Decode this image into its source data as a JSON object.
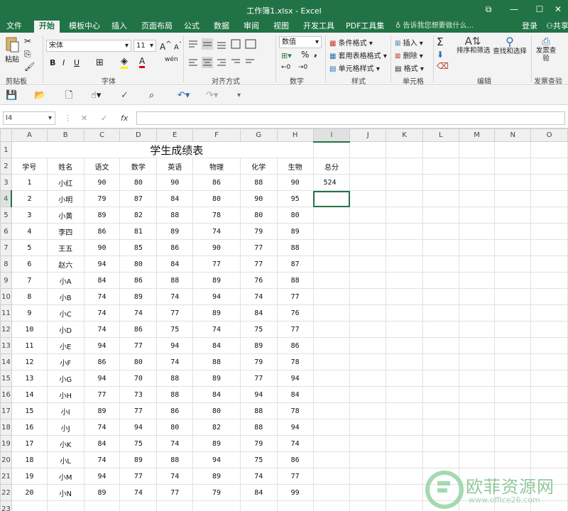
{
  "window": {
    "title": "工作簿1.xlsx - Excel",
    "controls": [
      "⧉",
      "—",
      "☐",
      "✕"
    ]
  },
  "tabs": [
    "文件",
    "开始",
    "模板中心",
    "插入",
    "页面布局",
    "公式",
    "数据",
    "审阅",
    "视图",
    "开发工具",
    "PDF工具集"
  ],
  "active_tab": "开始",
  "tell_me": "告诉我您想要做什么...",
  "login": "登录",
  "share": "共享",
  "ribbon": {
    "clipboard": {
      "paste": "粘贴",
      "label": "剪贴板"
    },
    "font": {
      "name": "宋体",
      "size": "11",
      "grow": "A",
      "shrink": "A",
      "bold": "B",
      "italic": "I",
      "underline": "U",
      "wen": "wén",
      "label": "字体"
    },
    "alignment": {
      "label": "对齐方式"
    },
    "number": {
      "format": "数值",
      "percent": "%",
      "comma": ",",
      "label": "数字"
    },
    "styles": {
      "conditional": "条件格式",
      "table": "套用表格格式",
      "cell": "单元格样式",
      "label": "样式"
    },
    "cells": {
      "insert": "插入",
      "delete": "删除",
      "format": "格式",
      "label": "单元格"
    },
    "editing": {
      "sum": "Σ",
      "sort": "排序和筛选",
      "find": "查找和选择",
      "label": "编辑"
    },
    "invoice": {
      "check": "发票查验",
      "label": "发票查验"
    }
  },
  "formula_bar": {
    "name_box": "I4",
    "cancel": "✕",
    "confirm": "✓",
    "fx": "fx",
    "value": ""
  },
  "columns": [
    "A",
    "B",
    "C",
    "D",
    "E",
    "F",
    "G",
    "H",
    "I",
    "J",
    "K",
    "L",
    "M",
    "N",
    "O"
  ],
  "selected_cell": "I4",
  "sheet": {
    "title": "学生成绩表",
    "headers": [
      "学号",
      "姓名",
      "语文",
      "数学",
      "英语",
      "物理",
      "化学",
      "生物",
      "总分"
    ],
    "rows": [
      [
        "1",
        "小红",
        "90",
        "80",
        "90",
        "86",
        "88",
        "90",
        "524"
      ],
      [
        "2",
        "小明",
        "79",
        "87",
        "84",
        "80",
        "90",
        "95",
        ""
      ],
      [
        "3",
        "小黄",
        "89",
        "82",
        "88",
        "78",
        "80",
        "80",
        ""
      ],
      [
        "4",
        "李四",
        "86",
        "81",
        "89",
        "74",
        "79",
        "89",
        ""
      ],
      [
        "5",
        "王五",
        "90",
        "85",
        "86",
        "90",
        "77",
        "88",
        ""
      ],
      [
        "6",
        "赵六",
        "94",
        "80",
        "84",
        "77",
        "77",
        "87",
        ""
      ],
      [
        "7",
        "小A",
        "84",
        "86",
        "88",
        "89",
        "76",
        "88",
        ""
      ],
      [
        "8",
        "小B",
        "74",
        "89",
        "74",
        "94",
        "74",
        "77",
        ""
      ],
      [
        "9",
        "小C",
        "74",
        "74",
        "77",
        "89",
        "84",
        "76",
        ""
      ],
      [
        "10",
        "小D",
        "74",
        "86",
        "75",
        "74",
        "75",
        "77",
        ""
      ],
      [
        "11",
        "小E",
        "94",
        "77",
        "94",
        "84",
        "89",
        "86",
        ""
      ],
      [
        "12",
        "小F",
        "86",
        "80",
        "74",
        "88",
        "79",
        "78",
        ""
      ],
      [
        "13",
        "小G",
        "94",
        "70",
        "88",
        "89",
        "77",
        "94",
        ""
      ],
      [
        "14",
        "小H",
        "77",
        "73",
        "88",
        "84",
        "94",
        "84",
        ""
      ],
      [
        "15",
        "小I",
        "89",
        "77",
        "86",
        "80",
        "88",
        "78",
        ""
      ],
      [
        "16",
        "小J",
        "74",
        "94",
        "80",
        "82",
        "88",
        "94",
        ""
      ],
      [
        "17",
        "小K",
        "84",
        "75",
        "74",
        "89",
        "79",
        "74",
        ""
      ],
      [
        "18",
        "小L",
        "74",
        "89",
        "88",
        "94",
        "75",
        "86",
        ""
      ],
      [
        "19",
        "小M",
        "94",
        "77",
        "74",
        "89",
        "74",
        "77",
        ""
      ],
      [
        "20",
        "小N",
        "89",
        "74",
        "77",
        "79",
        "84",
        "99",
        ""
      ]
    ]
  },
  "watermark": {
    "text": "欧菲资源网",
    "url": "www.office26.com"
  },
  "colors": {
    "accent": "#217346",
    "grid": "#e1e1e1",
    "header_bg": "#f0f0f0"
  }
}
